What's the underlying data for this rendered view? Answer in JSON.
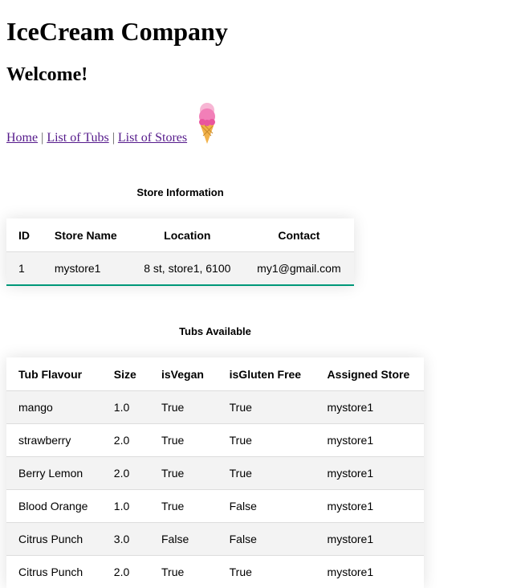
{
  "page": {
    "title": "IceCream Company",
    "welcome": "Welcome!"
  },
  "nav": {
    "home": "Home",
    "sep1": "|",
    "tubs": "List of Tubs",
    "sep2": "|",
    "stores": "List of Stores"
  },
  "store_section": {
    "caption": "Store Information",
    "headers": [
      "ID",
      "Store Name",
      "Location",
      "Contact"
    ],
    "rows": [
      [
        "1",
        "mystore1",
        "8 st, store1, 6100",
        "my1@gmail.com"
      ]
    ]
  },
  "tubs_section": {
    "caption": "Tubs Available",
    "headers": [
      "Tub Flavour",
      "Size",
      "isVegan",
      "isGluten Free",
      "Assigned Store"
    ],
    "rows": [
      [
        "mango",
        "1.0",
        "True",
        "True",
        "mystore1"
      ],
      [
        "strawberry",
        "2.0",
        "True",
        "True",
        "mystore1"
      ],
      [
        "Berry Lemon",
        "2.0",
        "True",
        "True",
        "mystore1"
      ],
      [
        "Blood Orange",
        "1.0",
        "True",
        "False",
        "mystore1"
      ],
      [
        "Citrus Punch",
        "3.0",
        "False",
        "False",
        "mystore1"
      ],
      [
        "Citrus Punch",
        "2.0",
        "True",
        "True",
        "mystore1"
      ]
    ]
  },
  "icons": {
    "logo": "ice-cream-cone-icon"
  },
  "colors": {
    "accent": "#009879",
    "link": "#551a8b",
    "row_alt": "#f3f3f3",
    "ice_cream_pink": "#f48fc1",
    "cone": "#f2b24a"
  }
}
